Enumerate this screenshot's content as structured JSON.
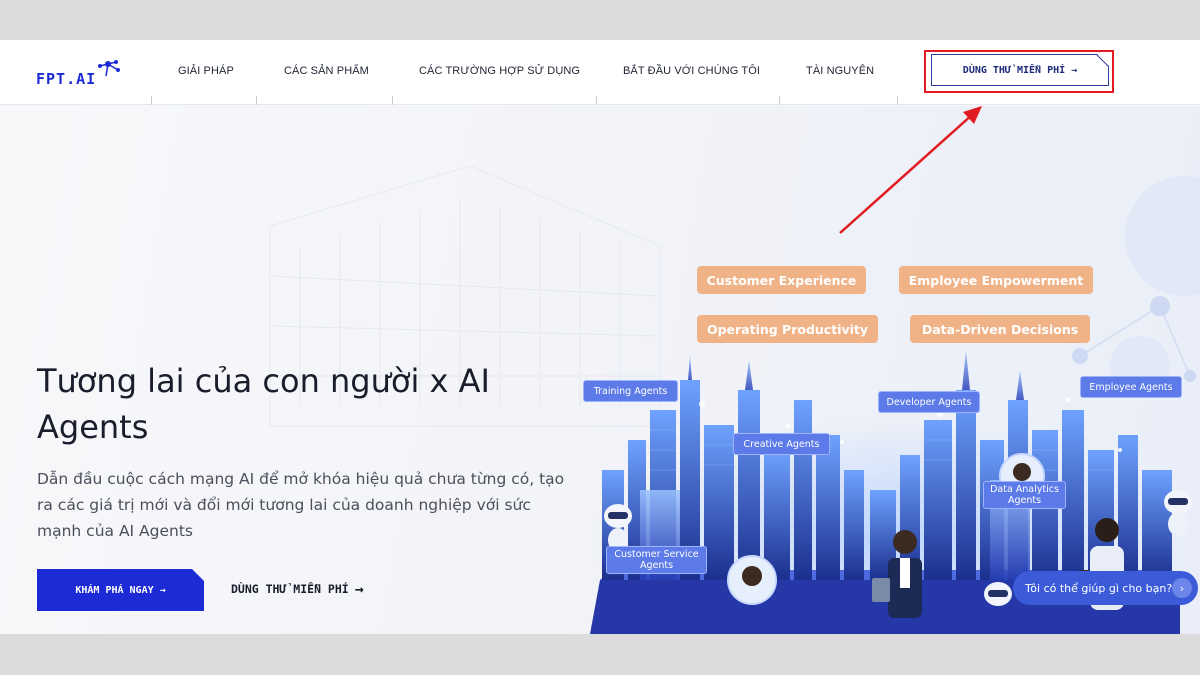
{
  "brand": {
    "logo_text": "FPT.AI",
    "accent": "#1c2bd6",
    "highlight": "#e01b22"
  },
  "nav": {
    "items": [
      {
        "label": "GIẢI PHÁP"
      },
      {
        "label": "CÁC SẢN PHẨM"
      },
      {
        "label": "CÁC TRƯỜNG HỢP SỬ DỤNG"
      },
      {
        "label": "BẮT ĐẦU VỚI CHÚNG TÔI"
      },
      {
        "label": "TÀI NGUYÊN"
      }
    ],
    "trial_label": "DÙNG THỬ MIỄN PHÍ",
    "arrow_icon": "arrow-right-icon"
  },
  "hero": {
    "title": "Tương lai của con người x AI Agents",
    "subtitle": "Dẫn đầu cuộc cách mạng AI để mở khóa hiệu quả chưa từng có, tạo ra các giá trị mới và đổi mới tương lai của doanh nghiệp với sức mạnh của AI Agents",
    "primary_cta": "KHÁM PHÁ NGAY",
    "secondary_cta": "DÙNG THỬ MIỄN PHÍ"
  },
  "illustration": {
    "pills": [
      "Customer Experience",
      "Employee Empowerment",
      "Operating Productivity",
      "Data-Driven Decisions"
    ],
    "agents": [
      "Training Agents",
      "Creative Agents",
      "Developer Agents",
      "Employee Agents",
      "Data Analytics Agents",
      "Customer Service Agents"
    ]
  },
  "chat": {
    "prompt": "Tôi có thể giúp gì cho bạn?"
  }
}
